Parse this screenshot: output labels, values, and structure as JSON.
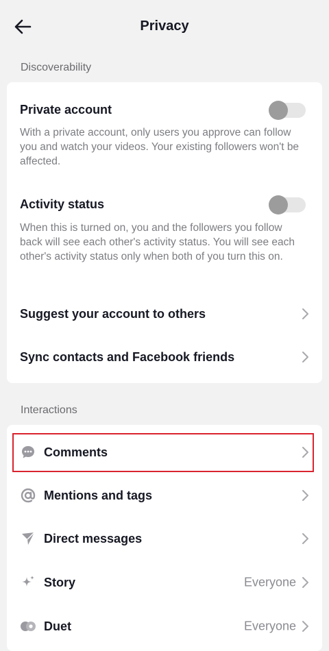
{
  "header": {
    "title": "Privacy"
  },
  "sections": {
    "discoverability": {
      "label": "Discoverability",
      "private_account": {
        "label": "Private account",
        "enabled": false,
        "description": "With a private account, only users you approve can follow you and watch your videos. Your existing followers won't be affected."
      },
      "activity_status": {
        "label": "Activity status",
        "enabled": false,
        "description": "When this is turned on, you and the followers you follow back will see each other's activity status. You will see each other's activity status only when both of you turn this on."
      },
      "suggest_account": {
        "label": "Suggest your account to others"
      },
      "sync_contacts": {
        "label": "Sync contacts and Facebook friends"
      }
    },
    "interactions": {
      "label": "Interactions",
      "items": [
        {
          "label": "Comments",
          "icon": "comment-icon",
          "value": ""
        },
        {
          "label": "Mentions and tags",
          "icon": "at-icon",
          "value": ""
        },
        {
          "label": "Direct messages",
          "icon": "send-icon",
          "value": ""
        },
        {
          "label": "Story",
          "icon": "sparkle-icon",
          "value": "Everyone"
        },
        {
          "label": "Duet",
          "icon": "duet-icon",
          "value": "Everyone"
        }
      ]
    }
  },
  "colors": {
    "highlight": "#d9232e",
    "toggle_off": "#9c9c9c"
  }
}
